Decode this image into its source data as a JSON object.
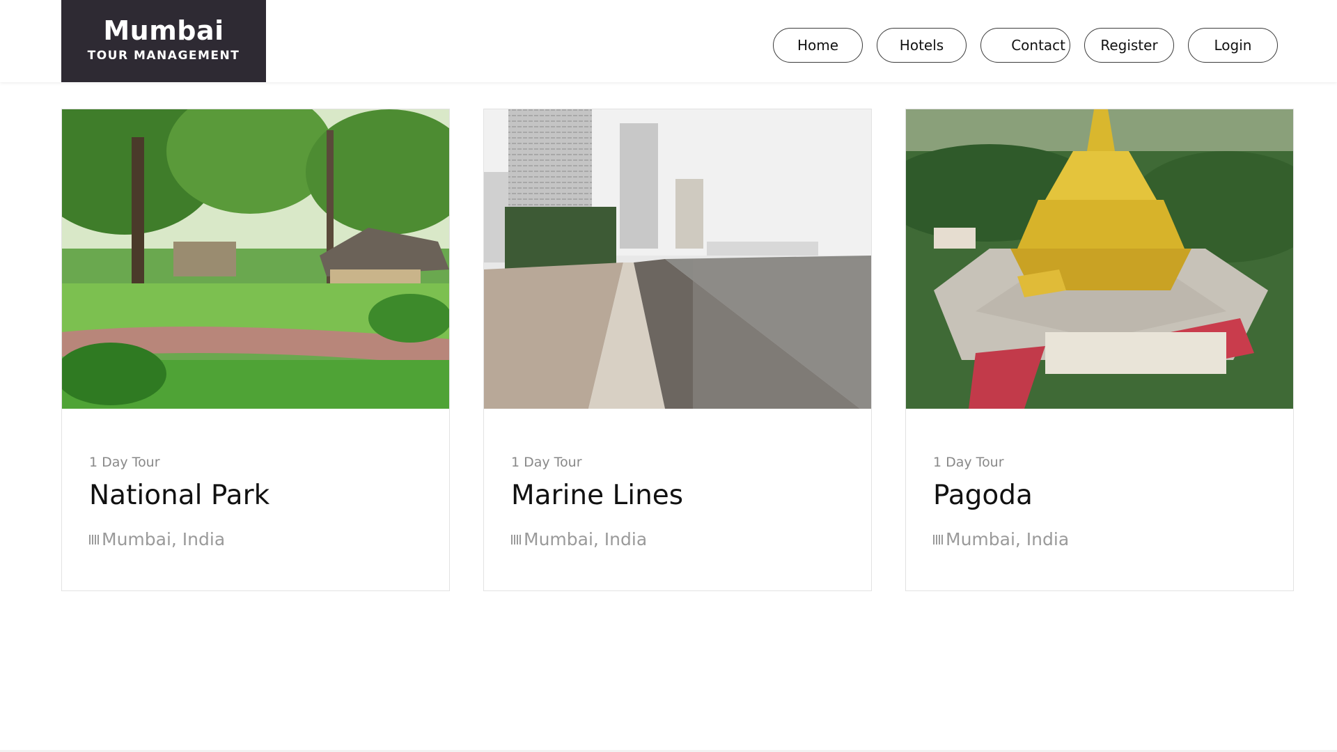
{
  "logo": {
    "title": "Mumbai",
    "subtitle": "TOUR MANAGEMENT"
  },
  "nav": {
    "items": [
      "Home",
      "Hotels",
      "Contact",
      "Register",
      "Login"
    ]
  },
  "tours": [
    {
      "tag": "1 Day Tour",
      "title": "National Park",
      "location": "Mumbai, India",
      "image": "park-photo"
    },
    {
      "tag": "1 Day Tour",
      "title": "Marine Lines",
      "location": "Mumbai, India",
      "image": "seafront-photo"
    },
    {
      "tag": "1 Day Tour",
      "title": "Pagoda",
      "location": "Mumbai, India",
      "image": "pagoda-photo"
    }
  ],
  "colors": {
    "logo_bg": "#2e2a33",
    "nav_border": "#3a3a3a",
    "muted_text": "#9a9a9a"
  },
  "icons": {
    "location": "location-icon"
  }
}
